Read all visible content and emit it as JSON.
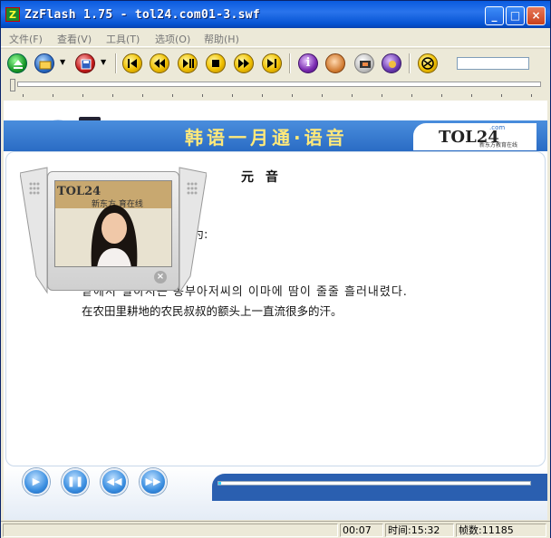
{
  "window": {
    "app_icon": "Z",
    "title": "ZzFlash 1.75  - tol24.com01-3.swf",
    "min_glyph": "_",
    "max_glyph": "□",
    "close_glyph": "×"
  },
  "menu": [
    "文件(F)",
    "查看(V)",
    "工具(T)",
    "选项(O)",
    "帮助(H)"
  ],
  "toolbar": {
    "buttons": [
      "eject-icon",
      "open-folder-icon",
      "save-icon",
      "skip-start-icon",
      "rewind-icon",
      "step-icon",
      "stop-icon",
      "fast-forward-icon",
      "skip-end-icon",
      "info-icon",
      "face-icon",
      "film-icon",
      "settings-icon",
      "web-icon"
    ]
  },
  "stage": {
    "banner_title": "韩语一月通·语音",
    "logo_text": "TOL24",
    "logo_com": ".com",
    "logo_sub": "新东方教育在线",
    "video_caption": "新东方 育在线",
    "heading": "元 音",
    "subtext": "为:",
    "korean_line": "밭에서 일하시는 농부아저씨의 이마에 땀이 줄줄 흘러내렸다.",
    "chinese_line": "在农田里耕地的农民叔叔的额头上一直流很多的汗。",
    "progress_fraction": 0.01,
    "accent": "#2a6cc4"
  },
  "controls": {
    "play_glyph": "▶",
    "pause_glyph": "❚❚",
    "back_glyph": "◀◀",
    "forward_glyph": "▶▶"
  },
  "status": {
    "elapsed": "00:07",
    "time": "时间:15:32",
    "frames": "帧数:11185"
  }
}
